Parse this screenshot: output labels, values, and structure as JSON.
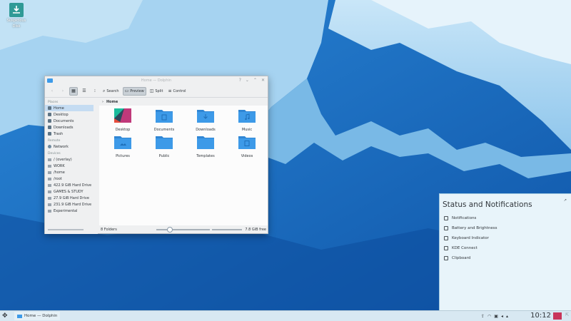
{
  "desktop": {
    "icon_label": "Suspicious",
    "icon_sublabel": "Disk"
  },
  "window": {
    "title": "Home — Dolphin",
    "toolbar": {
      "search": "Search",
      "preview": "Preview",
      "split": "Split",
      "control": "Control"
    },
    "breadcrumb": "Home",
    "places_heading": "Places",
    "places": [
      "Home",
      "Desktop",
      "Documents",
      "Downloads",
      "Trash"
    ],
    "remote_heading": "Remote",
    "remote": [
      "Network"
    ],
    "devices_heading": "Devices",
    "devices": [
      "/ (overlay)",
      "WORK",
      "/home",
      "/root",
      "422.9 GiB Hard Drive",
      "GAMES & STUDY",
      "27.9 GiB Hard Drive",
      "231.9 GiB Hard Drive",
      "Experimental"
    ],
    "files": [
      "Desktop",
      "Documents",
      "Downloads",
      "Music",
      "Pictures",
      "Public",
      "Templates",
      "Videos"
    ],
    "status_left": "8 Folders",
    "status_right": "7.8 GiB free"
  },
  "notifications": {
    "title": "Status and Notifications",
    "items": [
      "Notifications",
      "Battery and Brightness",
      "Keyboard Indicator",
      "KDE Connect",
      "Clipboard"
    ]
  },
  "taskbar": {
    "task_label": "Home — Dolphin",
    "clock": "10:12"
  },
  "colors": {
    "folder": "#3d9ae8",
    "folder_dark": "#2f86d4",
    "accent": "#3daee9"
  }
}
